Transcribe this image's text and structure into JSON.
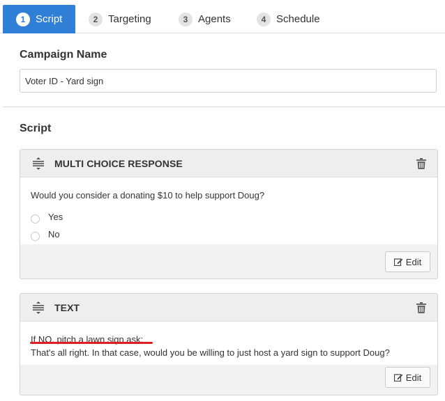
{
  "tabs": [
    {
      "num": "1",
      "label": "Script"
    },
    {
      "num": "2",
      "label": "Targeting"
    },
    {
      "num": "3",
      "label": "Agents"
    },
    {
      "num": "4",
      "label": "Schedule"
    }
  ],
  "campaign": {
    "label": "Campaign Name",
    "value": "Voter ID - Yard sign"
  },
  "script": {
    "label": "Script",
    "cards": [
      {
        "title": "MULTI CHOICE RESPONSE",
        "question": "Would you consider a donating $10 to help support Doug?",
        "options": [
          "Yes",
          "No"
        ],
        "edit_label": "Edit"
      },
      {
        "title": "TEXT",
        "line1": "If NO, pitch a lawn sign ask:",
        "line2": "That's all right. In that case, would you be willing to just host a yard sign to support Doug?",
        "edit_label": "Edit"
      }
    ]
  },
  "colors": {
    "accent": "#2f7fd6",
    "annotation": "#e01c24"
  }
}
